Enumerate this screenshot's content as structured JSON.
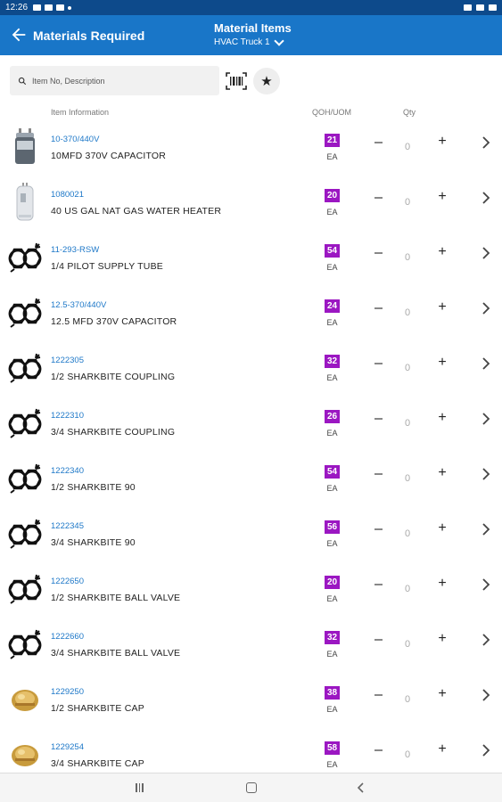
{
  "status_bar": {
    "time": "12:26"
  },
  "app_bar": {
    "back_label": "Materials Required",
    "title": "Material Items",
    "subtitle": "HVAC Truck 1"
  },
  "search": {
    "placeholder": "Item No, Description"
  },
  "columns": {
    "info": "Item Information",
    "qoh": "QOH/UOM",
    "qty": "Qty"
  },
  "colors": {
    "app_bar": "#1976c8",
    "status_bar": "#0d4a8b",
    "badge": "#9b17c2",
    "link": "#1e78c8"
  },
  "items": [
    {
      "no": "10-370/440V",
      "desc": "10MFD 370V CAPACITOR",
      "qoh": "21",
      "uom": "EA",
      "qty": "0",
      "thumb": "capacitor"
    },
    {
      "no": "1080021",
      "desc": "40 US GAL NAT GAS WATER HEATER",
      "qoh": "20",
      "uom": "EA",
      "qty": "0",
      "thumb": "water-heater"
    },
    {
      "no": "11-293-RSW",
      "desc": "1/4 PILOT SUPPLY TUBE",
      "qoh": "54",
      "uom": "EA",
      "qty": "0",
      "thumb": "generic"
    },
    {
      "no": "12.5-370/440V",
      "desc": "12.5 MFD 370V CAPACITOR",
      "qoh": "24",
      "uom": "EA",
      "qty": "0",
      "thumb": "generic"
    },
    {
      "no": "1222305",
      "desc": "1/2 SHARKBITE COUPLING",
      "qoh": "32",
      "uom": "EA",
      "qty": "0",
      "thumb": "generic"
    },
    {
      "no": "1222310",
      "desc": "3/4 SHARKBITE COUPLING",
      "qoh": "26",
      "uom": "EA",
      "qty": "0",
      "thumb": "generic"
    },
    {
      "no": "1222340",
      "desc": "1/2 SHARKBITE 90",
      "qoh": "54",
      "uom": "EA",
      "qty": "0",
      "thumb": "generic"
    },
    {
      "no": "1222345",
      "desc": "3/4 SHARKBITE 90",
      "qoh": "56",
      "uom": "EA",
      "qty": "0",
      "thumb": "generic"
    },
    {
      "no": "1222650",
      "desc": "1/2 SHARKBITE BALL VALVE",
      "qoh": "20",
      "uom": "EA",
      "qty": "0",
      "thumb": "generic"
    },
    {
      "no": "1222660",
      "desc": "3/4 SHARKBITE BALL VALVE",
      "qoh": "32",
      "uom": "EA",
      "qty": "0",
      "thumb": "generic"
    },
    {
      "no": "1229250",
      "desc": "1/2 SHARKBITE CAP",
      "qoh": "38",
      "uom": "EA",
      "qty": "0",
      "thumb": "brass-cap"
    },
    {
      "no": "1229254",
      "desc": "3/4 SHARKBITE CAP",
      "qoh": "58",
      "uom": "EA",
      "qty": "0",
      "thumb": "brass-cap"
    }
  ]
}
